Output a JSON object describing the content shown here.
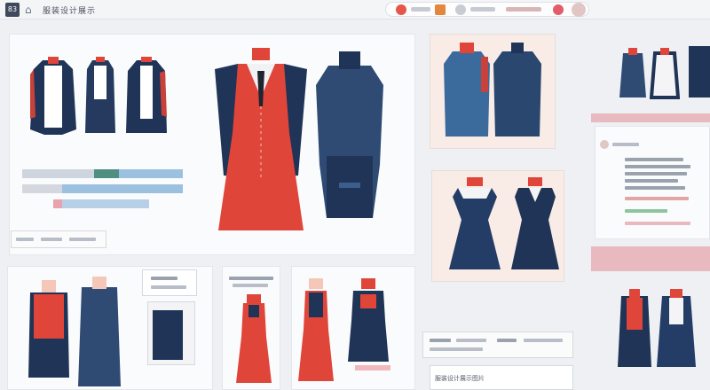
{
  "app": {
    "logo_text": "83",
    "title": "服装设计展示"
  },
  "footer": {
    "caption": "服装设计展示图片"
  },
  "colors": {
    "navy": "#1f3456",
    "red": "#e0453a",
    "blue": "#3b5e8c",
    "tile": "#f9ece6",
    "accent_pink": "#e6b4ba"
  },
  "icons": [
    "logo-icon",
    "home-icon",
    "alert-icon",
    "orange-icon",
    "user-icon",
    "pin-icon",
    "profile-icon"
  ]
}
